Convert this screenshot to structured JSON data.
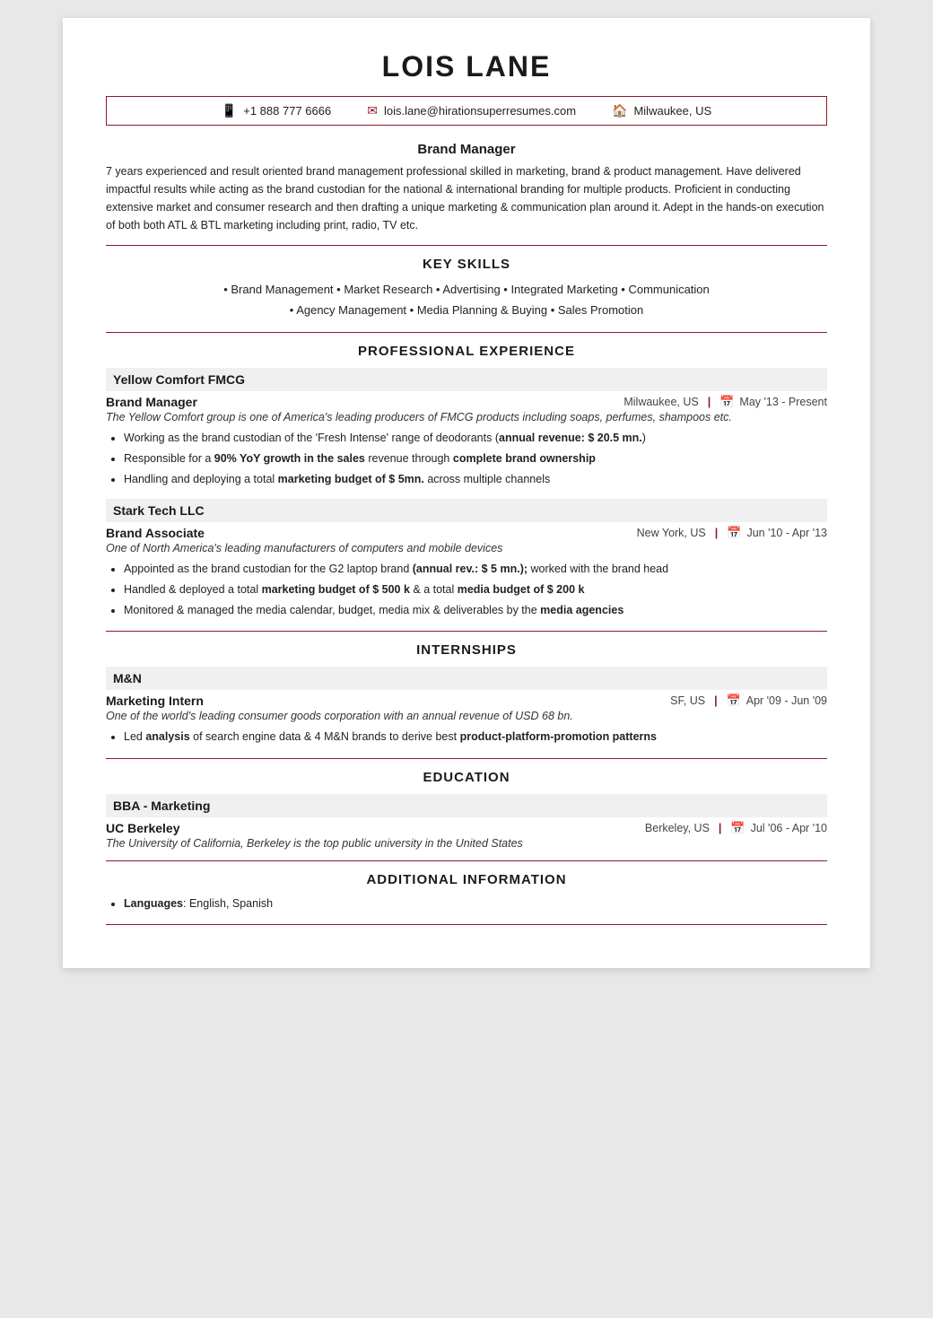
{
  "header": {
    "name": "LOIS LANE",
    "contact": {
      "phone": "+1 888 777 6666",
      "email": "lois.lane@hirationsuperresumes.com",
      "location": "Milwaukee, US"
    }
  },
  "summary": {
    "title": "Brand Manager",
    "text": "7 years experienced and result oriented brand management professional skilled in marketing, brand & product management. Have delivered impactful results while acting as the brand custodian for the national & international branding for multiple products. Proficient in conducting extensive market and consumer research and then drafting a unique marketing & communication plan around it. Adept in the hands-on execution of both both ATL & BTL marketing including print, radio, TV etc."
  },
  "skills": {
    "section_title": "KEY SKILLS",
    "line1": "• Brand Management • Market Research • Advertising • Integrated Marketing • Communication",
    "line2": "• Agency Management • Media Planning & Buying • Sales Promotion"
  },
  "professional_experience": {
    "section_title": "PROFESSIONAL EXPERIENCE",
    "jobs": [
      {
        "company": "Yellow Comfort FMCG",
        "role": "Brand Manager",
        "location": "Milwaukee, US",
        "dates": "May '13 - Present",
        "description": "The Yellow Comfort group is one of America's leading producers of FMCG products including soaps, perfumes, shampoos etc.",
        "bullets": [
          "Working as the brand custodian of the 'Fresh Intense' range of deodorants (annual revenue: $ 20.5 mn.)",
          "Responsible for a 90% YoY growth in the sales revenue through complete brand ownership",
          "Handling and deploying a total marketing budget of $ 5mn. across multiple channels"
        ],
        "bullets_bold": [
          {
            "text": "annual revenue: $ 20.5 mn.",
            "bold": true
          },
          {
            "text": "90% YoY growth in the sales",
            "bold": true
          },
          {
            "text": "complete brand ownership",
            "bold": true
          },
          {
            "text": "marketing budget of $ 5mn.",
            "bold": true
          }
        ]
      },
      {
        "company": "Stark Tech LLC",
        "role": "Brand Associate",
        "location": "New York, US",
        "dates": "Jun '10 - Apr '13",
        "description": "One of North America's leading manufacturers of computers and mobile devices",
        "bullets": [
          "Appointed as the brand custodian for the G2 laptop brand (annual rev.: $ 5 mn.); worked with the brand head",
          "Handled & deployed a total marketing budget of $ 500 k & a total media budget of $ 200 k",
          "Monitored & managed the media calendar, budget, media mix & deliverables by the media agencies"
        ]
      }
    ]
  },
  "internships": {
    "section_title": "INTERNSHIPS",
    "items": [
      {
        "company": "M&N",
        "role": "Marketing Intern",
        "location": "SF, US",
        "dates": "Apr '09 - Jun '09",
        "description": "One of the world's leading consumer goods corporation with an annual revenue of USD 68 bn.",
        "bullets": [
          "Led analysis of search engine data & 4 M&N brands to derive best product-platform-promotion patterns"
        ]
      }
    ]
  },
  "education": {
    "section_title": "EDUCATION",
    "items": [
      {
        "degree": "BBA - Marketing",
        "institution": "UC Berkeley",
        "location": "Berkeley, US",
        "dates": "Jul '06 - Apr '10",
        "description": "The University of California, Berkeley is the top public university in the United States"
      }
    ]
  },
  "additional": {
    "section_title": "ADDITIONAL INFORMATION",
    "items": [
      {
        "label": "Languages",
        "value": "English, Spanish"
      }
    ]
  }
}
